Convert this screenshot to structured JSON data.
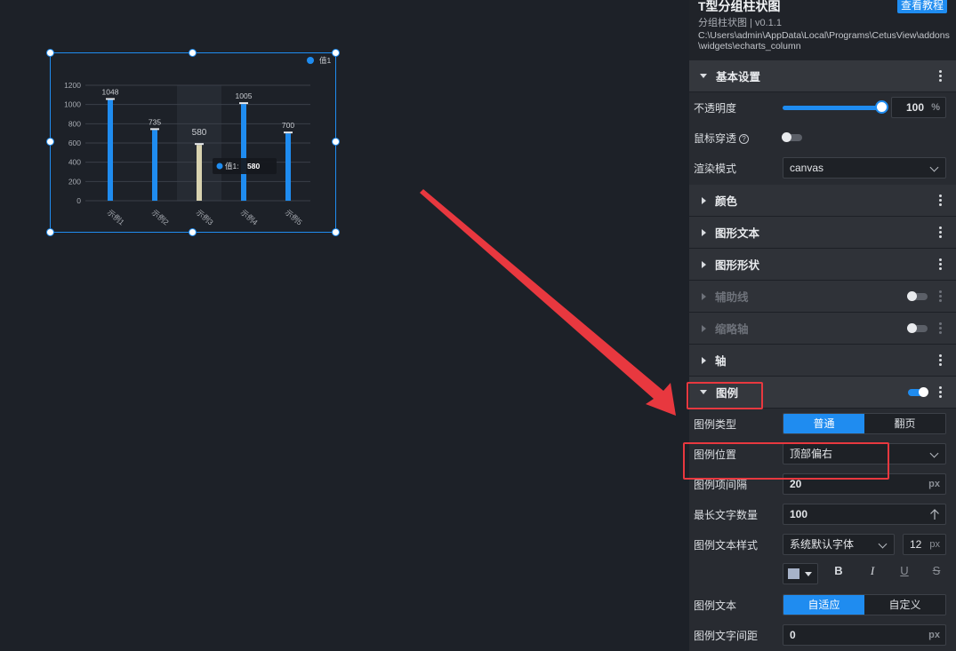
{
  "panel": {
    "title": "T型分组柱状图",
    "tutorial_button": "查看教程",
    "subtitle": "分组柱状图 | v0.1.1",
    "path": "C:\\Users\\admin\\AppData\\Local\\Programs\\CetusView\\addons\\widgets\\echarts_column"
  },
  "basic": {
    "section_label": "基本设置",
    "opacity_label": "不透明度",
    "opacity_value": "100",
    "opacity_unit": "%",
    "opacity_level": 1.0,
    "mouse_through_label": "鼠标穿透",
    "mouse_through_help": "?",
    "mouse_through_on": false,
    "render_mode_label": "渲染模式",
    "render_mode_value": "canvas"
  },
  "sections": [
    {
      "label": "颜色",
      "dim": false,
      "toggle": false
    },
    {
      "label": "图形文本",
      "dim": false,
      "toggle": false
    },
    {
      "label": "图形形状",
      "dim": false,
      "toggle": false
    },
    {
      "label": "辅助线",
      "dim": true,
      "toggle": true,
      "toggle_on": false
    },
    {
      "label": "缩略轴",
      "dim": true,
      "toggle": true,
      "toggle_on": false
    },
    {
      "label": "轴",
      "dim": false,
      "toggle": false
    }
  ],
  "legend": {
    "section_label": "图例",
    "toggle_on": true,
    "type_label": "图例类型",
    "type_options": [
      "普通",
      "翻页"
    ],
    "type_selected": "普通",
    "position_label": "图例位置",
    "position_value": "顶部偏右",
    "gap_label": "图例项间隔",
    "gap_value": "20",
    "gap_unit": "px",
    "max_chars_label": "最长文字数量",
    "max_chars_value": "100",
    "text_style_label": "图例文本样式",
    "font_family_value": "系统默认字体",
    "font_size_value": "12",
    "font_size_unit": "px",
    "bold_label": "B",
    "italic_label": "I",
    "underline_label": "U",
    "strike_label": "S",
    "text_label": "图例文本",
    "text_options": [
      "自适应",
      "自定义"
    ],
    "text_selected": "自适应",
    "letter_spacing_label": "图例文字间距",
    "letter_spacing_value": "0",
    "letter_spacing_unit": "px"
  },
  "colors": {
    "accent": "#1f8cf0",
    "highlight_bar": "#d9d3b0",
    "annotation_red": "#e8383f"
  },
  "chart_data": {
    "type": "bar",
    "categories": [
      "示例1",
      "示例2",
      "示例3",
      "示例4",
      "示例5"
    ],
    "series": [
      {
        "name": "值1",
        "values": [
          1048,
          735,
          580,
          1005,
          700
        ]
      }
    ],
    "ylim": [
      0,
      1200
    ],
    "yticks": [
      0,
      200,
      400,
      600,
      800,
      1000,
      1200
    ],
    "highlighted_index": 2,
    "tooltip": {
      "series": "值1:",
      "value": "580"
    },
    "legend_position": "top-right",
    "grid": true
  }
}
